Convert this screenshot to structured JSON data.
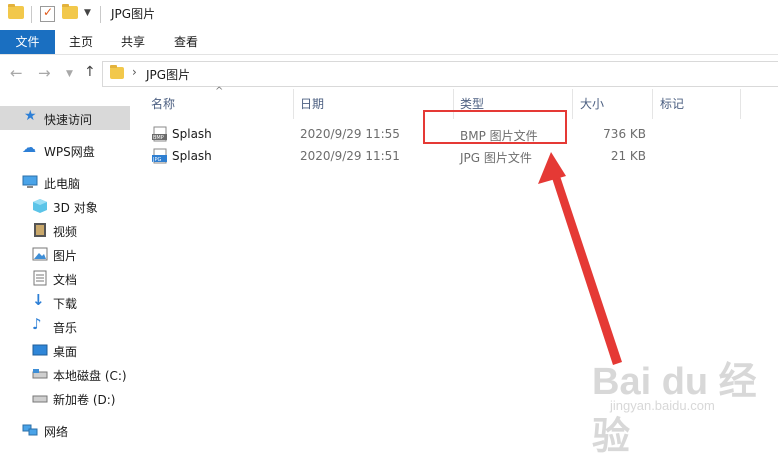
{
  "window": {
    "title": "JPG图片"
  },
  "ribbon": {
    "tabs": [
      "文件",
      "主页",
      "共享",
      "查看"
    ]
  },
  "address": {
    "path": "JPG图片"
  },
  "nav": {
    "items": [
      {
        "label": "快速访问",
        "icon": "star-icon"
      },
      {
        "label": "WPS网盘",
        "icon": "cloud-icon"
      },
      {
        "label": "此电脑",
        "icon": "computer-icon"
      },
      {
        "label": "3D 对象",
        "icon": "cube-icon"
      },
      {
        "label": "视频",
        "icon": "video-icon"
      },
      {
        "label": "图片",
        "icon": "picture-icon"
      },
      {
        "label": "文档",
        "icon": "document-icon"
      },
      {
        "label": "下载",
        "icon": "download-icon"
      },
      {
        "label": "音乐",
        "icon": "music-icon"
      },
      {
        "label": "桌面",
        "icon": "desktop-icon"
      },
      {
        "label": "本地磁盘 (C:)",
        "icon": "drive-icon"
      },
      {
        "label": "新加卷 (D:)",
        "icon": "drive-icon"
      },
      {
        "label": "网络",
        "icon": "network-icon"
      }
    ]
  },
  "columns": {
    "name": "名称",
    "date": "日期",
    "type": "类型",
    "size": "大小",
    "tags": "标记"
  },
  "files": [
    {
      "name": "Splash",
      "date": "2020/9/29 11:55",
      "type": "BMP 图片文件",
      "size": "736 KB",
      "icon_text": "BMP"
    },
    {
      "name": "Splash",
      "date": "2020/9/29 11:51",
      "type": "JPG 图片文件",
      "size": "21 KB",
      "icon_text": "JPG"
    }
  ],
  "annotation_color": "#e53935",
  "accent_color": "#1a6fc1",
  "watermark": {
    "logo": "Bai du 经验",
    "url": "jingyan.baidu.com"
  }
}
